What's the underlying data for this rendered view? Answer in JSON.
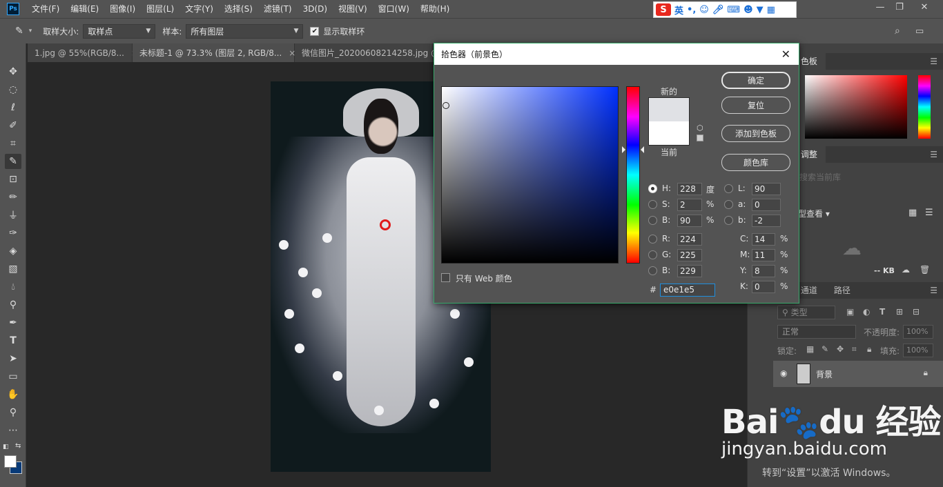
{
  "menubar": {
    "logo": "Ps",
    "items": [
      "文件(F)",
      "编辑(E)",
      "图像(I)",
      "图层(L)",
      "文字(Y)",
      "选择(S)",
      "滤镜(T)",
      "3D(D)",
      "视图(V)",
      "窗口(W)",
      "帮助(H)"
    ],
    "ime": {
      "logo": "S",
      "mode": "英",
      "punct": "•,"
    }
  },
  "options": {
    "sample_size_label": "取样大小:",
    "sample_size_value": "取样点",
    "sample_label": "样本:",
    "sample_value": "所有图层",
    "show_ring_label": "显示取样环",
    "show_ring_checked": true
  },
  "tabs": [
    {
      "label": "1.jpg @ 55%(RGB/8...",
      "close": "×"
    },
    {
      "label": "未标题-1 @ 73.3% (图层 2, RGB/8...",
      "close": "×"
    },
    {
      "label": "微信图片_20200608214258.jpg @",
      "close": ""
    }
  ],
  "dialog": {
    "title": "拾色器（前景色）",
    "close": "✕",
    "new_label": "新的",
    "current_label": "当前",
    "new_color": "#e0e1e5",
    "current_color": "#ffffff",
    "buttons": {
      "ok": "确定",
      "reset": "复位",
      "add_to_swatches": "添加到色板",
      "color_libraries": "颜色库"
    },
    "web_only_label": "只有 Web 颜色",
    "fields": {
      "H": {
        "label": "H:",
        "value": "228",
        "unit": "度"
      },
      "S": {
        "label": "S:",
        "value": "2",
        "unit": "%"
      },
      "Bv": {
        "label": "B:",
        "value": "90",
        "unit": "%"
      },
      "R": {
        "label": "R:",
        "value": "224"
      },
      "G": {
        "label": "G:",
        "value": "225"
      },
      "Bc": {
        "label": "B:",
        "value": "229"
      },
      "L": {
        "label": "L:",
        "value": "90"
      },
      "a": {
        "label": "a:",
        "value": "0"
      },
      "b": {
        "label": "b:",
        "value": "-2"
      },
      "C": {
        "label": "C:",
        "value": "14",
        "unit": "%"
      },
      "M": {
        "label": "M:",
        "value": "11",
        "unit": "%"
      },
      "Y": {
        "label": "Y:",
        "value": "8",
        "unit": "%"
      },
      "K": {
        "label": "K:",
        "value": "0",
        "unit": "%"
      }
    },
    "hex_label": "#",
    "hex_value": "e0e1e5"
  },
  "panels": {
    "swatches_tab": "色板",
    "adjust_tab": "调整",
    "library_placeholder": "搜索当前库",
    "view_label": "型查看",
    "kb_label": "-- KB",
    "channels_tab": "通道",
    "paths_tab": "路径",
    "kind_label": "类型",
    "blend_mode": "正常",
    "opacity_label": "不透明度:",
    "opacity_value": "100%",
    "lock_label": "锁定:",
    "fill_label": "填充:",
    "fill_value": "100%",
    "layer_name": "背景"
  },
  "watermark": {
    "logo": "Bai🐾du 经验",
    "url": "jingyan.baidu.com",
    "activate": "转到“设置”以激活 Windows。"
  }
}
